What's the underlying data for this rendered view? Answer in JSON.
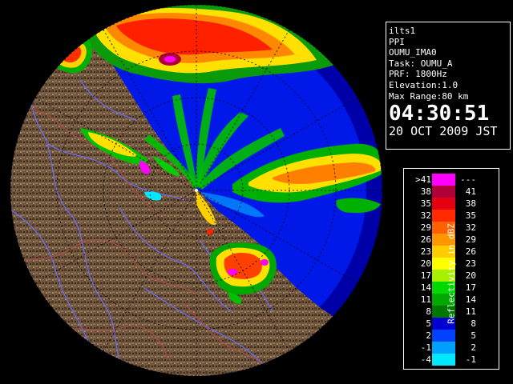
{
  "info": {
    "lines": [
      "ilts1",
      "PPI",
      "OUMU_IMA0",
      "Task: OUMU_A",
      "PRF: 1800Hz",
      "Elevation:1.0",
      "Max Range:80 km"
    ],
    "time": "04:30:51",
    "date": "20 OCT 2009 JST"
  },
  "legend": {
    "title": "Reflectivity in dBZ",
    "rows": [
      {
        "lo": ">41",
        "hi": "---",
        "color": "#ff00ff"
      },
      {
        "lo": "38",
        "hi": "41",
        "color": "#b0003a"
      },
      {
        "lo": "35",
        "hi": "38",
        "color": "#e40010"
      },
      {
        "lo": "32",
        "hi": "35",
        "color": "#ff2a00"
      },
      {
        "lo": "29",
        "hi": "32",
        "color": "#ff6000"
      },
      {
        "lo": "26",
        "hi": "29",
        "color": "#ff9600"
      },
      {
        "lo": "23",
        "hi": "26",
        "color": "#ffcc00"
      },
      {
        "lo": "20",
        "hi": "23",
        "color": "#ffff00"
      },
      {
        "lo": "17",
        "hi": "20",
        "color": "#a6f000"
      },
      {
        "lo": "14",
        "hi": "17",
        "color": "#00d800"
      },
      {
        "lo": "11",
        "hi": "14",
        "color": "#00a800"
      },
      {
        "lo": "8",
        "hi": "11",
        "color": "#007800"
      },
      {
        "lo": "5",
        "hi": "8",
        "color": "#0000d0"
      },
      {
        "lo": "2",
        "hi": "5",
        "color": "#0040ff"
      },
      {
        "lo": "-1",
        "hi": "2",
        "color": "#00a0ff"
      },
      {
        "lo": "-4",
        "hi": "-1",
        "color": "#00e8ff"
      }
    ]
  },
  "colors": {
    "sky": "#0018e8",
    "sky_edge": "#0000b0",
    "land": "#8a6a4a",
    "land_dark": "#4a3626",
    "rivers": "#6a6cff",
    "borders": "#b04a4a"
  }
}
